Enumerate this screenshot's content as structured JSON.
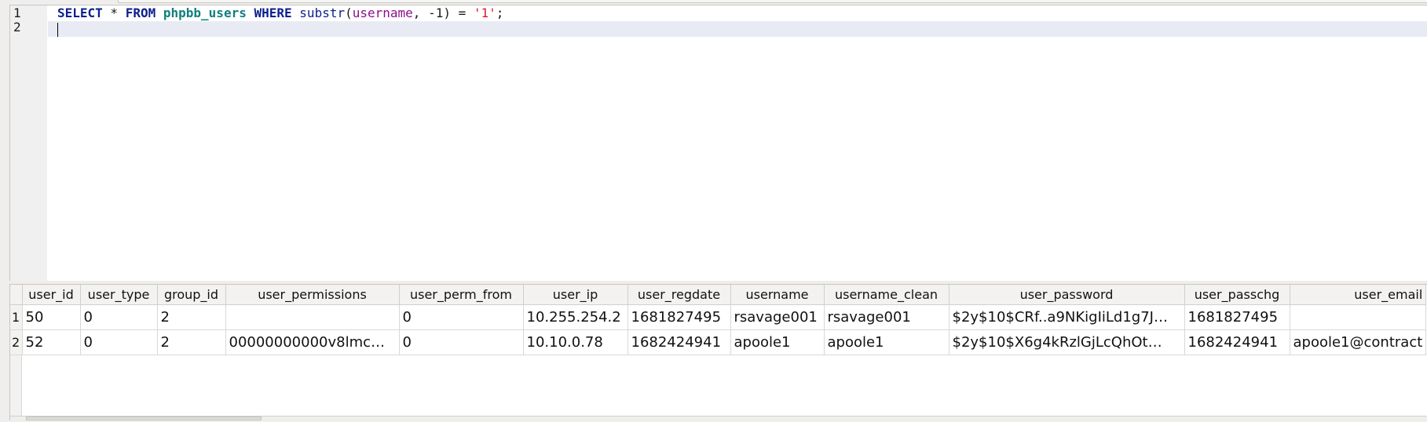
{
  "editor": {
    "line_numbers": [
      "1",
      "2"
    ],
    "query": {
      "select_kw": "SELECT",
      "star": " * ",
      "from_kw": "FROM",
      "table": "phpbb_users",
      "where_kw": "WHERE",
      "func": "substr",
      "open_paren": "(",
      "column": "username",
      "args_rest": ", -1) = ",
      "literal": "'1'",
      "terminator": ";"
    }
  },
  "results": {
    "columns": [
      "user_id",
      "user_type",
      "group_id",
      "user_permissions",
      "user_perm_from",
      "user_ip",
      "user_regdate",
      "username",
      "username_clean",
      "user_password",
      "user_passchg",
      "user_email"
    ],
    "rows": [
      {
        "row_number": "1",
        "cells": [
          "50",
          "0",
          "2",
          "",
          "0",
          "10.255.254.2",
          "1681827495",
          "rsavage001",
          "rsavage001",
          "$2y$10$CRf..a9NKigIiLd1g7J…",
          "1681827495",
          ""
        ]
      },
      {
        "row_number": "2",
        "cells": [
          "52",
          "0",
          "2",
          "00000000000v8lmc…",
          "0",
          "10.10.0.78",
          "1682424941",
          "apoole1",
          "apoole1",
          "$2y$10$X6g4kRzlGjLcQhOt…",
          "1682424941",
          "apoole1@contract"
        ]
      }
    ]
  }
}
